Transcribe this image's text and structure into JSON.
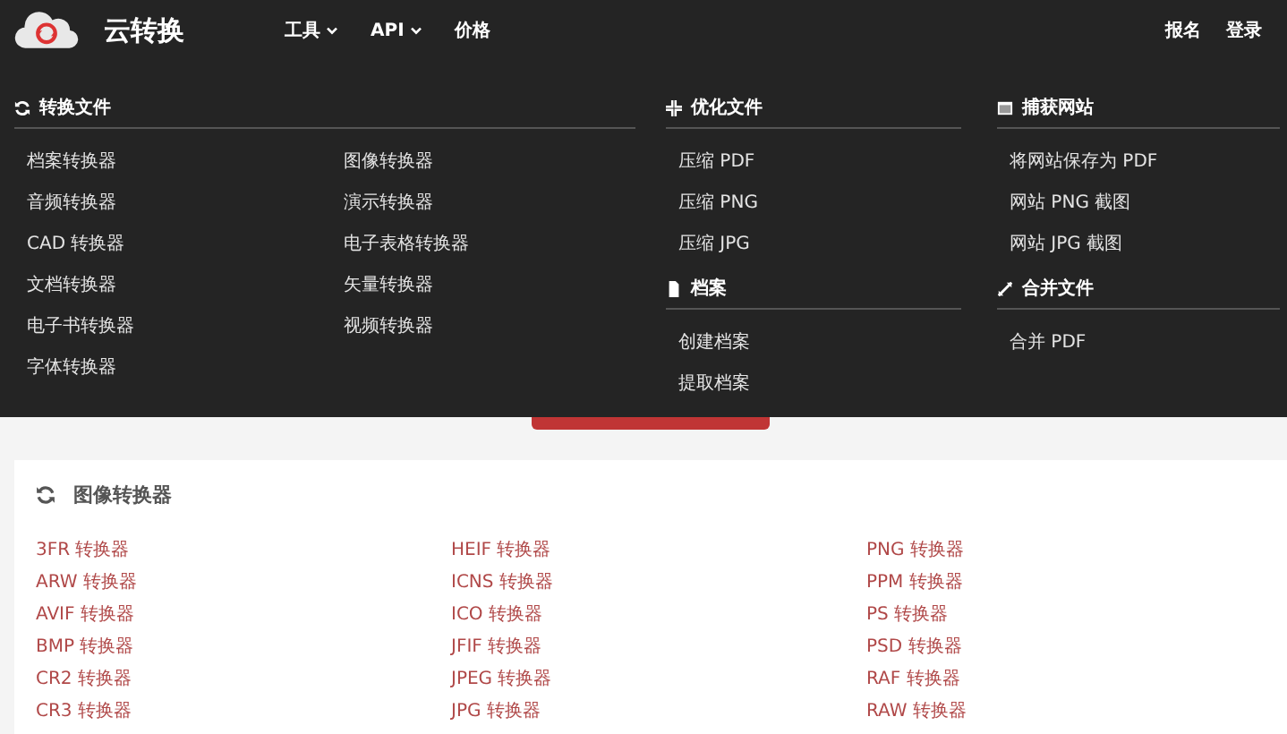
{
  "header": {
    "brand": "云转换",
    "nav": [
      {
        "label": "工具",
        "caret": true
      },
      {
        "label": "API",
        "caret": true
      },
      {
        "label": "价格",
        "caret": false
      }
    ],
    "account": [
      "报名",
      "登录"
    ]
  },
  "menu": {
    "columns": [
      {
        "sections": [
          {
            "kind": "convert",
            "title": "转换文件",
            "items": [
              "档案转换器",
              "图像转换器",
              "音频转换器",
              "演示转换器",
              "CAD 转换器",
              "电子表格转换器",
              "文档转换器",
              "矢量转换器",
              "电子书转换器",
              "视频转换器",
              "字体转换器"
            ]
          }
        ]
      },
      {
        "sections": [
          {
            "kind": "optimize",
            "title": "优化文件",
            "items": [
              "压缩 PDF",
              "压缩 PNG",
              "压缩 JPG"
            ]
          },
          {
            "kind": "archive",
            "title": "档案",
            "items": [
              "创建档案",
              "提取档案"
            ]
          }
        ]
      },
      {
        "sections": [
          {
            "kind": "capture",
            "title": "捕获网站",
            "items": [
              "将网站保存为 PDF",
              "网站 PNG 截图",
              "网站 JPG 截图"
            ]
          },
          {
            "kind": "merge",
            "title": "合并文件",
            "items": [
              "合并 PDF"
            ]
          }
        ]
      }
    ]
  },
  "card": {
    "title": "图像转换器",
    "columns": [
      [
        "3FR 转换器",
        "ARW 转换器",
        "AVIF 转换器",
        "BMP 转换器",
        "CR2 转换器",
        "CR3 转换器"
      ],
      [
        "HEIF 转换器",
        "ICNS 转换器",
        "ICO 转换器",
        "JFIF 转换器",
        "JPEG 转换器",
        "JPG 转换器"
      ],
      [
        "PNG 转换器",
        "PPM 转换器",
        "PS 转换器",
        "PSD 转换器",
        "RAF 转换器",
        "RAW 转换器"
      ]
    ]
  }
}
